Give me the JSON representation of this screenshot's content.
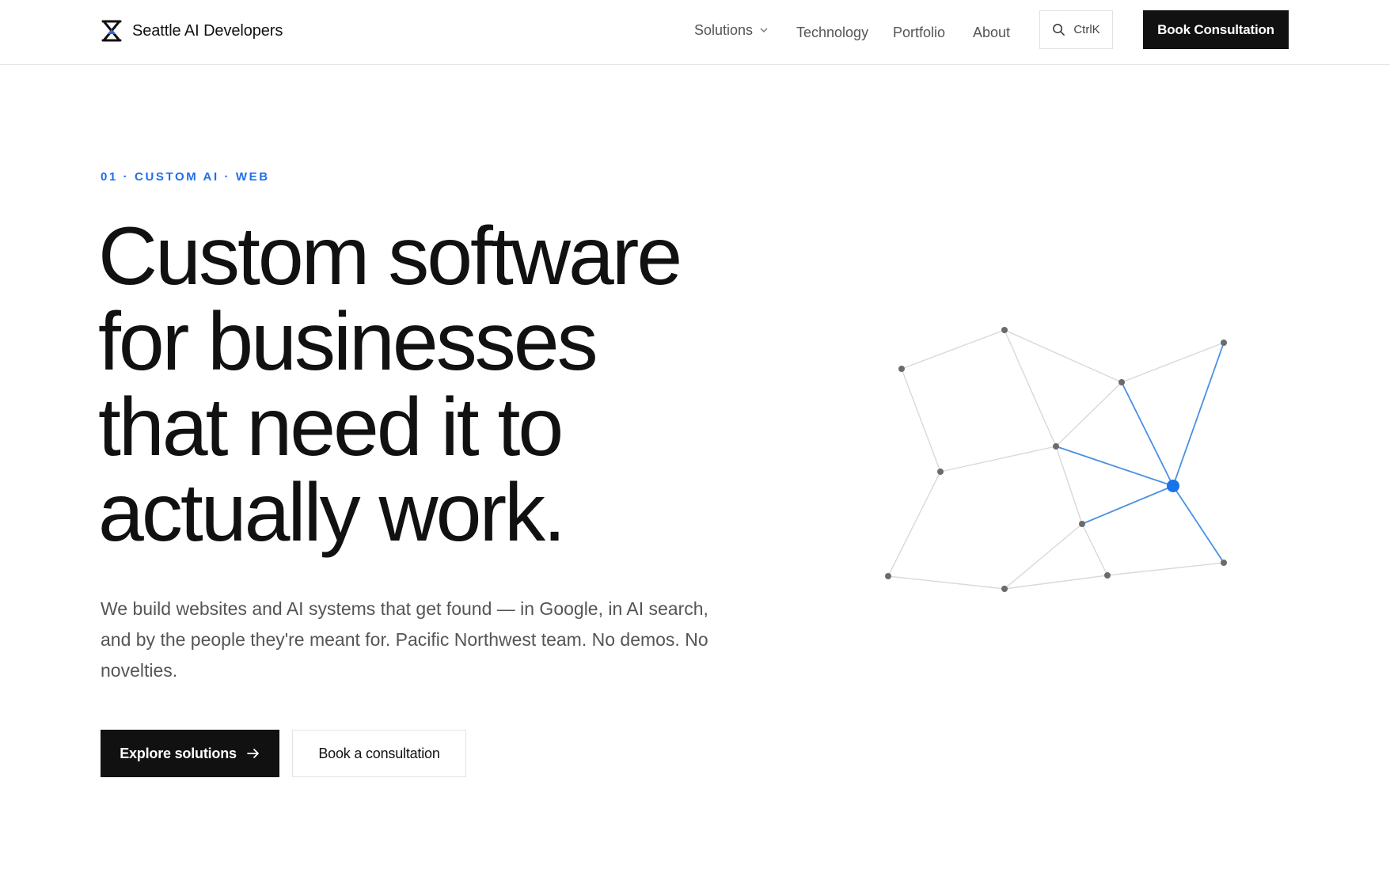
{
  "header": {
    "brand_name": "Seattle AI Developers",
    "logo_icon": "hourglass-x-logo-icon",
    "nav": {
      "solutions": "Solutions",
      "technology": "Technology",
      "portfolio": "Portfolio",
      "about": "About"
    },
    "search_shortcut": "CtrlK",
    "book_button": "Book Consultation"
  },
  "hero": {
    "eyebrow": "01 · CUSTOM AI · WEB",
    "headline_lines": [
      "Custom software",
      "for businesses",
      "that need it to",
      "actually work."
    ],
    "subtext": "We build websites and AI systems that get found — in Google, in AI search, and by the people they're meant for. Pacific Northwest team. No demos. No novelties.",
    "primary_cta": "Explore solutions",
    "secondary_cta": "Book a consultation"
  },
  "colors": {
    "accent": "#1f6feb",
    "text": "#111111",
    "muted": "#555555",
    "network_node": "#6b6b6b",
    "network_line": "#d9d9d9",
    "network_active": "#1a73e8"
  },
  "icons": {
    "chevron": "chevron-down-icon",
    "search": "search-icon",
    "arrow": "arrow-right-icon"
  }
}
